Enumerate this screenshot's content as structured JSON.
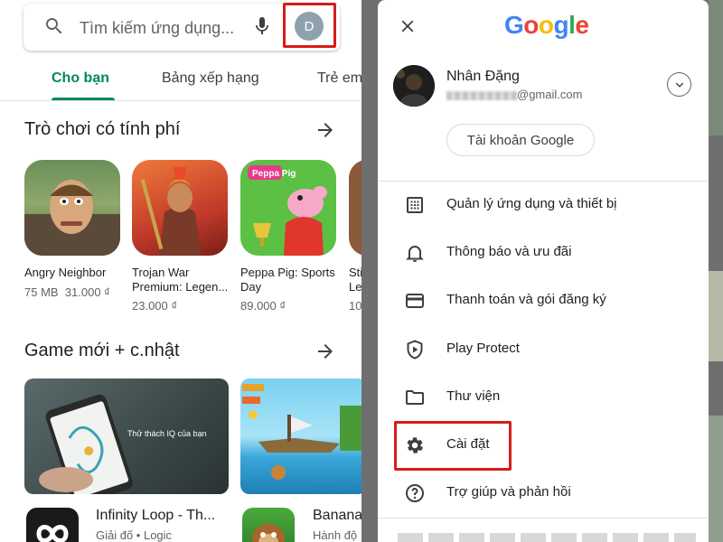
{
  "left": {
    "search": {
      "placeholder": "Tìm kiếm ứng dụng..."
    },
    "avatar_letter": "D",
    "tabs": [
      {
        "label": "Cho bạn"
      },
      {
        "label": "Bảng xếp hạng"
      },
      {
        "label": "Trẻ em"
      }
    ],
    "section1": {
      "title": "Trò chơi có tính phí",
      "apps": [
        {
          "name": "Angry Neighbor",
          "size": "75 MB",
          "price": "31.000 ₫"
        },
        {
          "name": "Trojan War Premium: Legen...",
          "price": "23.000 ₫"
        },
        {
          "name": "Peppa Pig: Sports Day",
          "price": "89.000 ₫"
        },
        {
          "name": "Sti Le",
          "price": "10"
        }
      ]
    },
    "section2": {
      "title": "Game mới + c.nhật",
      "banner_text": "Thử thách IQ của bạn",
      "games": [
        {
          "name": "Infinity Loop - Th...",
          "meta": "Giải đố • Logic"
        },
        {
          "name": "Banana",
          "meta": "Hành độ"
        }
      ]
    }
  },
  "dialog": {
    "logo": [
      "G",
      "o",
      "o",
      "g",
      "l",
      "e"
    ],
    "logo_colors": [
      "#4285F4",
      "#EA4335",
      "#FBBC05",
      "#4285F4",
      "#34A853",
      "#EA4335"
    ],
    "user_name": "Nhân Đặng",
    "user_email_domain": "@gmail.com",
    "account_button": "Tài khoản Google",
    "menu": [
      {
        "label": "Quản lý ứng dụng và thiết bị",
        "icon": "grid-icon"
      },
      {
        "label": "Thông báo và ưu đãi",
        "icon": "bell-icon"
      },
      {
        "label": "Thanh toán và gói đăng ký",
        "icon": "card-icon"
      },
      {
        "label": "Play Protect",
        "icon": "shield-play-icon"
      },
      {
        "label": "Thư viện",
        "icon": "folder-icon"
      },
      {
        "label": "Cài đặt",
        "icon": "gear-icon"
      },
      {
        "label": "Trợ giúp và phản hồi",
        "icon": "help-icon"
      }
    ]
  },
  "colors": {
    "accent": "#01875f",
    "highlight": "#d71b1b"
  }
}
